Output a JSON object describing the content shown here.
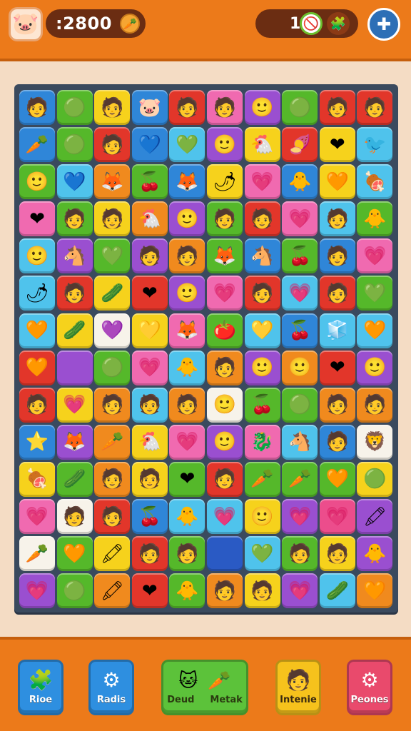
{
  "header": {
    "avatar_icon": "🐷",
    "score": ":2800",
    "score_icon": "🥕",
    "lives_count": "1",
    "lives_icon": "🚫",
    "puzzle_icon": "🧩",
    "settings_icon": "✚"
  },
  "palette": {
    "b": "#2f86d8",
    "g": "#55b82a",
    "y": "#f6d21c",
    "r": "#e2362a",
    "p": "#9a4fd0",
    "k": "#f06ab0",
    "o": "#f08a1e",
    "l": "#4fc3ec",
    "w": "#f7f3ea",
    "d": "#2a5ac4",
    "n": "#ec4d8c"
  },
  "board": {
    "rows": [
      [
        [
          "b",
          "🧑"
        ],
        [
          "g",
          "🟢"
        ],
        [
          "y",
          "🧑"
        ],
        [
          "b",
          "🐷"
        ],
        [
          "r",
          "🧑"
        ],
        [
          "k",
          "🧑"
        ],
        [
          "p",
          "🙂"
        ],
        [
          "g",
          "🟢"
        ],
        [
          "r",
          "🧑"
        ],
        [
          "r",
          "🧑"
        ]
      ],
      [
        [
          "b",
          "🥕"
        ],
        [
          "g",
          "🟢"
        ],
        [
          "r",
          "🧑"
        ],
        [
          "b",
          "💙"
        ],
        [
          "l",
          "💚"
        ],
        [
          "p",
          "🙂"
        ],
        [
          "y",
          "🐔"
        ],
        [
          "r",
          "🍠"
        ],
        [
          "y",
          "❤"
        ],
        [
          "l",
          "🐦"
        ]
      ],
      [
        [
          "g",
          "🙂"
        ],
        [
          "l",
          "💙"
        ],
        [
          "o",
          "🦊"
        ],
        [
          "g",
          "🍒"
        ],
        [
          "b",
          "🦊"
        ],
        [
          "y",
          "🌶"
        ],
        [
          "k",
          "💗"
        ],
        [
          "b",
          "🐥"
        ],
        [
          "y",
          "🧡"
        ],
        [
          "l",
          "🍖"
        ]
      ],
      [
        [
          "k",
          "❤"
        ],
        [
          "g",
          "🧑"
        ],
        [
          "y",
          "🧑"
        ],
        [
          "o",
          "🐔"
        ],
        [
          "p",
          "🙂"
        ],
        [
          "g",
          "🧑"
        ],
        [
          "r",
          "🧑"
        ],
        [
          "k",
          "💗"
        ],
        [
          "l",
          "🧑"
        ],
        [
          "g",
          "🐥"
        ]
      ],
      [
        [
          "l",
          "🙂"
        ],
        [
          "p",
          "🐴"
        ],
        [
          "g",
          "💚"
        ],
        [
          "p",
          "🧑"
        ],
        [
          "o",
          "🧑"
        ],
        [
          "g",
          "🦊"
        ],
        [
          "b",
          "🐴"
        ],
        [
          "g",
          "🍒"
        ],
        [
          "b",
          "🧑"
        ],
        [
          "k",
          "💗"
        ]
      ],
      [
        [
          "l",
          "🌶"
        ],
        [
          "r",
          "🧑"
        ],
        [
          "y",
          "🥒"
        ],
        [
          "r",
          "❤"
        ],
        [
          "p",
          "🙂"
        ],
        [
          "k",
          "💗"
        ],
        [
          "r",
          "🧑"
        ],
        [
          "l",
          "💗"
        ],
        [
          "r",
          "🧑"
        ],
        [
          "g",
          "💚"
        ]
      ],
      [
        [
          "l",
          "🧡"
        ],
        [
          "y",
          "🥒"
        ],
        [
          "w",
          "💜"
        ],
        [
          "y",
          "💛"
        ],
        [
          "k",
          "🦊"
        ],
        [
          "g",
          "🍅"
        ],
        [
          "l",
          "💛"
        ],
        [
          "b",
          "🍒"
        ],
        [
          "l",
          "🧊"
        ],
        [
          "l",
          "🧡"
        ]
      ],
      [
        [
          "r",
          "🧡"
        ],
        [
          "p",
          ""
        ],
        [
          "g",
          "🟢"
        ],
        [
          "k",
          "💗"
        ],
        [
          "l",
          "🐥"
        ],
        [
          "o",
          "🧑"
        ],
        [
          "p",
          "🙂"
        ],
        [
          "o",
          "🙂"
        ],
        [
          "r",
          "❤"
        ],
        [
          "p",
          "🙂"
        ]
      ],
      [
        [
          "r",
          "🧑"
        ],
        [
          "y",
          "💗"
        ],
        [
          "o",
          "🧑"
        ],
        [
          "l",
          "🧑"
        ],
        [
          "o",
          "🧑"
        ],
        [
          "w",
          "🙂"
        ],
        [
          "g",
          "🍒"
        ],
        [
          "g",
          "🟢"
        ],
        [
          "o",
          "🧑"
        ],
        [
          "o",
          "🧑"
        ]
      ],
      [
        [
          "b",
          "⭐"
        ],
        [
          "p",
          "🦊"
        ],
        [
          "o",
          "🥕"
        ],
        [
          "y",
          "🐔"
        ],
        [
          "k",
          "💗"
        ],
        [
          "p",
          "🙂"
        ],
        [
          "k",
          "🐉"
        ],
        [
          "l",
          "🐴"
        ],
        [
          "b",
          "🧑"
        ],
        [
          "w",
          "🦁"
        ]
      ],
      [
        [
          "y",
          "🍖"
        ],
        [
          "g",
          "🥒"
        ],
        [
          "o",
          "🧑"
        ],
        [
          "y",
          "🧑"
        ],
        [
          "g",
          "❤"
        ],
        [
          "r",
          "🧑"
        ],
        [
          "g",
          "🥕"
        ],
        [
          "g",
          "🥕"
        ],
        [
          "g",
          "🧡"
        ],
        [
          "y",
          "🟢"
        ]
      ],
      [
        [
          "k",
          "💗"
        ],
        [
          "w",
          "🧑"
        ],
        [
          "r",
          "🧑"
        ],
        [
          "b",
          "🍒"
        ],
        [
          "l",
          "🐥"
        ],
        [
          "l",
          "💗"
        ],
        [
          "y",
          "🙂"
        ],
        [
          "p",
          "💗"
        ],
        [
          "n",
          "💗"
        ],
        [
          "p",
          "🖍"
        ]
      ],
      [
        [
          "w",
          "🥕"
        ],
        [
          "g",
          "🧡"
        ],
        [
          "y",
          "🖍"
        ],
        [
          "r",
          "🧑"
        ],
        [
          "g",
          "🧑"
        ],
        [
          "d",
          ""
        ],
        [
          "l",
          "💚"
        ],
        [
          "g",
          "🧑"
        ],
        [
          "y",
          "🧑"
        ],
        [
          "p",
          "🐥"
        ]
      ],
      [
        [
          "p",
          "💗"
        ],
        [
          "g",
          "🟢"
        ],
        [
          "o",
          "🖍"
        ],
        [
          "r",
          "❤"
        ],
        [
          "g",
          "🐥"
        ],
        [
          "o",
          "🧑"
        ],
        [
          "y",
          "🧑"
        ],
        [
          "p",
          "💗"
        ],
        [
          "l",
          "🥒"
        ],
        [
          "o",
          "🧡"
        ]
      ]
    ]
  },
  "toolbar": {
    "btn1": {
      "icon": "🧩",
      "label": "Rioe",
      "color": "#2e8fe0"
    },
    "btn2": {
      "icon": "⚙",
      "label": "Radis",
      "color": "#2e8fe0"
    },
    "btn3": {
      "icon_a": "🐱",
      "icon_b": "🥕",
      "label_a": "Deud",
      "label_b": "Metak",
      "color": "#5cc23a"
    },
    "btn4": {
      "icon": "🧑",
      "label": "Intenie",
      "color": "#f6c21c"
    },
    "btn5": {
      "icon": "⚙",
      "label": "Peones",
      "color": "#e94a6c"
    }
  }
}
